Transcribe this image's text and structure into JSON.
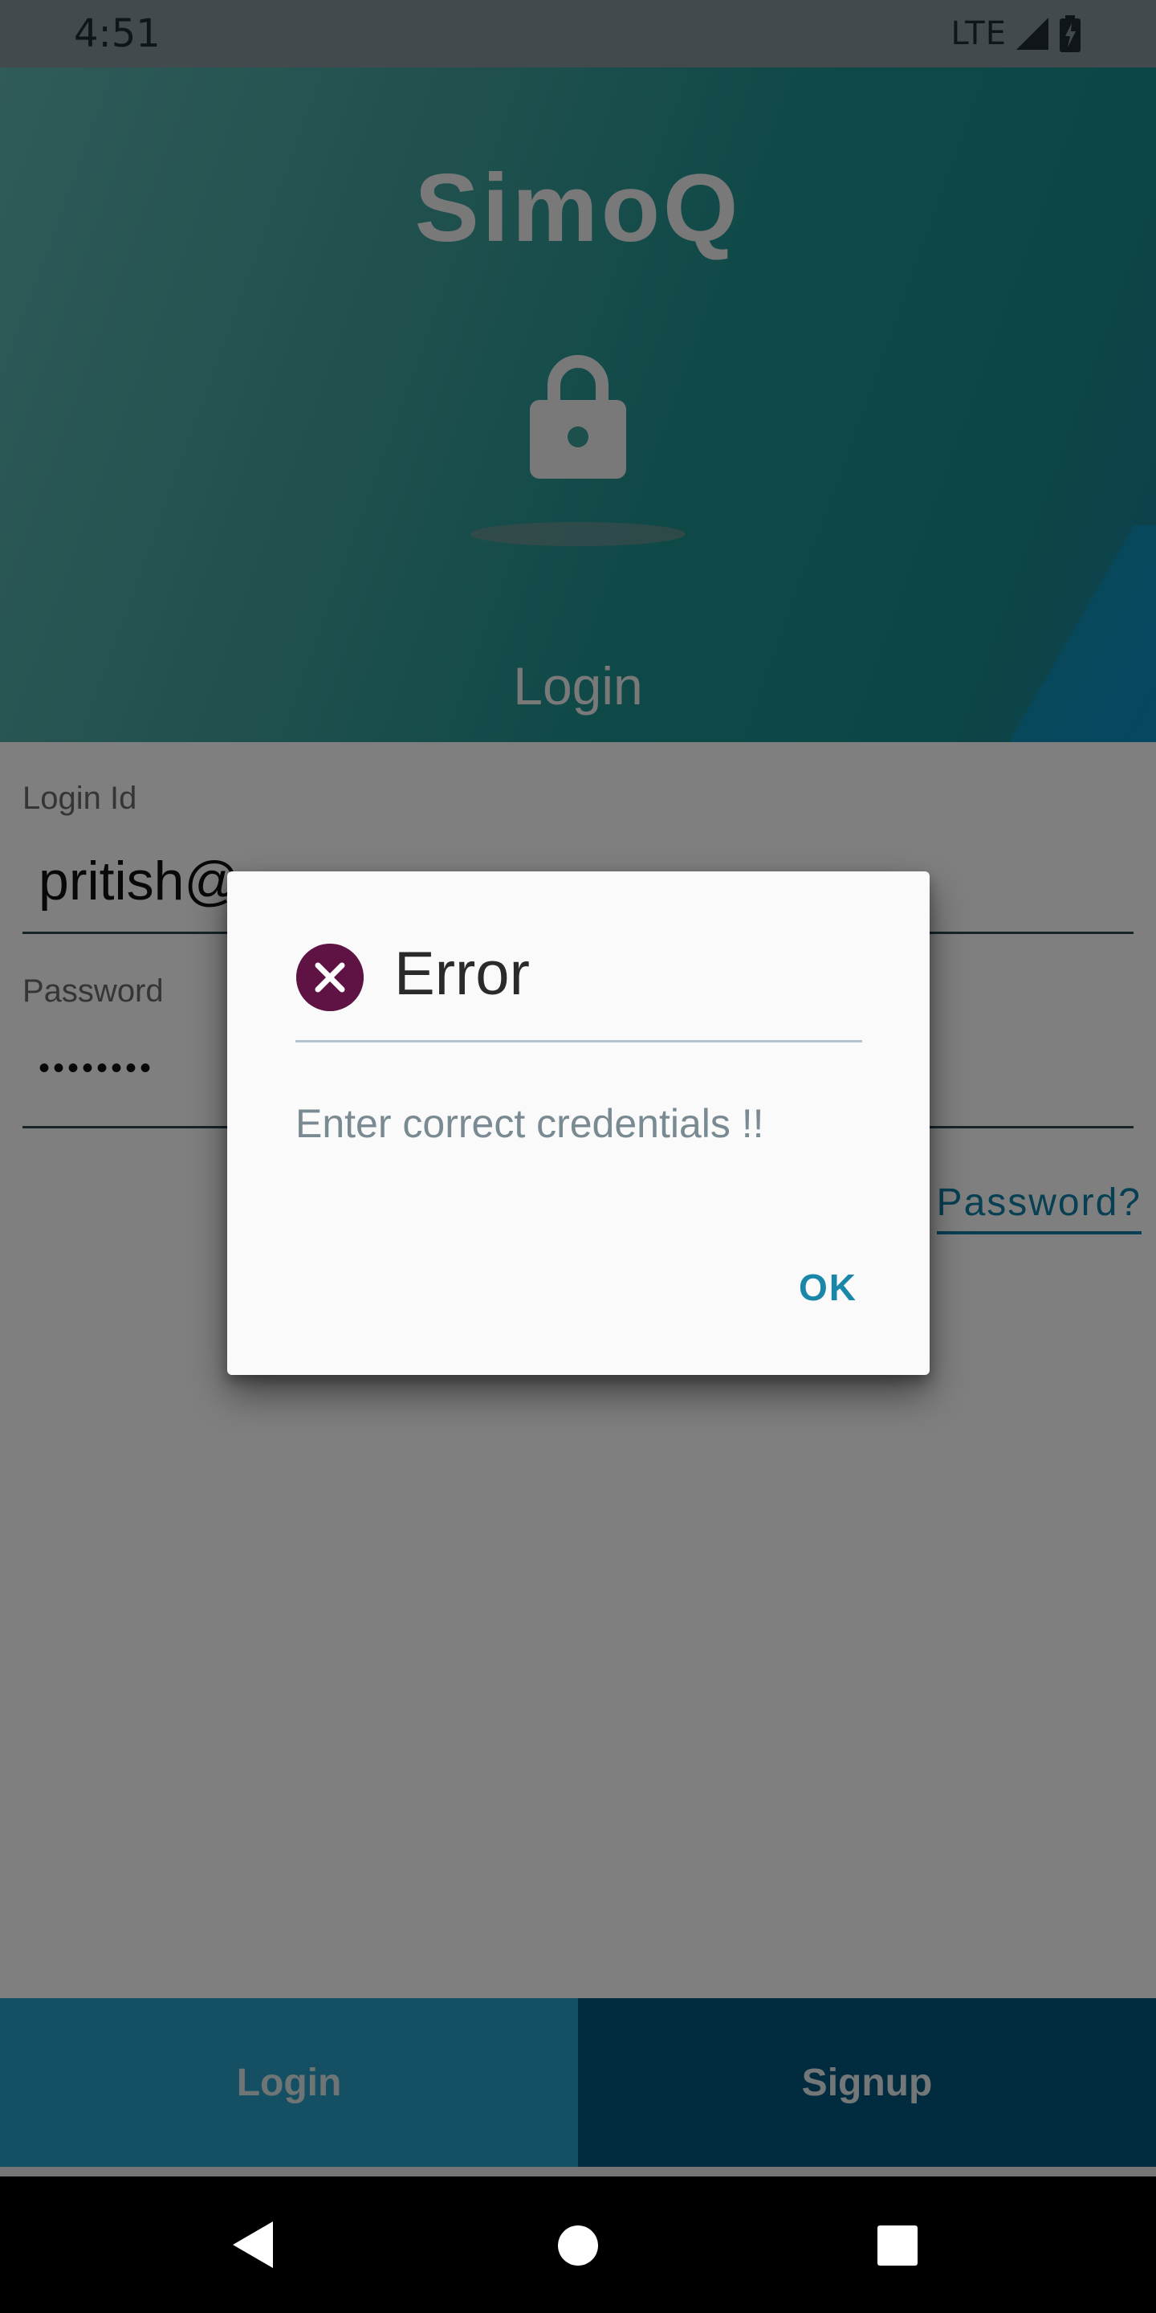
{
  "status_bar": {
    "time": "4:51",
    "network": "LTE"
  },
  "header": {
    "app_title": "SimoQ",
    "section_label": "Login"
  },
  "form": {
    "login_id": {
      "label": "Login Id",
      "value": "pritish@"
    },
    "password": {
      "label": "Password",
      "value": "••••••••"
    },
    "forgot_link": "Password?"
  },
  "bottom_tabs": {
    "login": "Login",
    "signup": "Signup"
  },
  "dialog": {
    "title": "Error",
    "message": "Enter correct credentials !!",
    "ok_label": "OK"
  },
  "colors": {
    "accent": "#1a86a8",
    "error_icon": "#5f1345",
    "tab_login": "#2a9fc8",
    "tab_signup": "#03567c"
  }
}
